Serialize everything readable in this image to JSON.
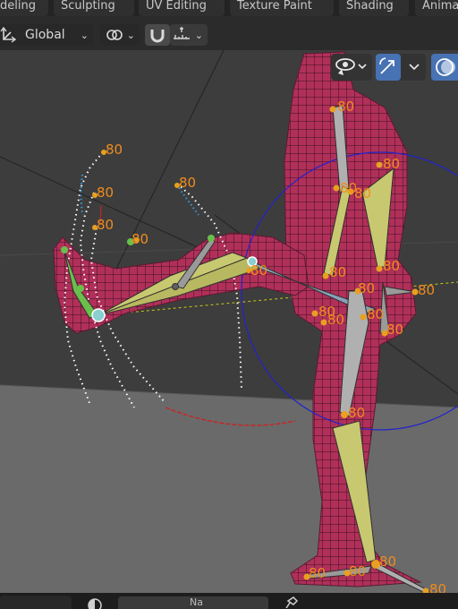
{
  "workspace_tabs": [
    "deling",
    "Sculpting",
    "UV Editing",
    "Texture Paint",
    "Shading",
    "Anima"
  ],
  "toolbar": {
    "orientation_label": "Global"
  },
  "bone_label": "80",
  "status": {
    "mode_text": "Na"
  },
  "colors": {
    "accent": "#4772b3",
    "bone_label": "#f08c1e",
    "mesh": "#b0305a",
    "bone_selected": "#c8c870"
  }
}
